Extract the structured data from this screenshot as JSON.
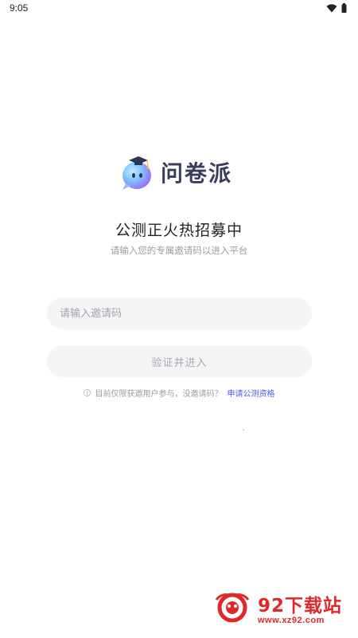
{
  "status_bar": {
    "time": "9:05"
  },
  "app": {
    "name": "问卷派",
    "brand_color": "#3a3d5c",
    "icon_gradient": [
      "#7ec9ff",
      "#9b6bff"
    ]
  },
  "header": {
    "title": "公测正火热招募中",
    "subtitle": "请输入您的专属邀请码以进入平台"
  },
  "form": {
    "invite_placeholder": "请输入邀请码",
    "invite_value": "",
    "submit_label": "验证并进入"
  },
  "notice": {
    "icon": "info-icon",
    "text": "目前仅限获邀用户参与，没邀请码？",
    "link_label": "申请公测资格",
    "link_color": "#4a5be8"
  },
  "watermark": {
    "title": "92下载站",
    "url": "www.xz92.com",
    "color": "#e0282a"
  }
}
